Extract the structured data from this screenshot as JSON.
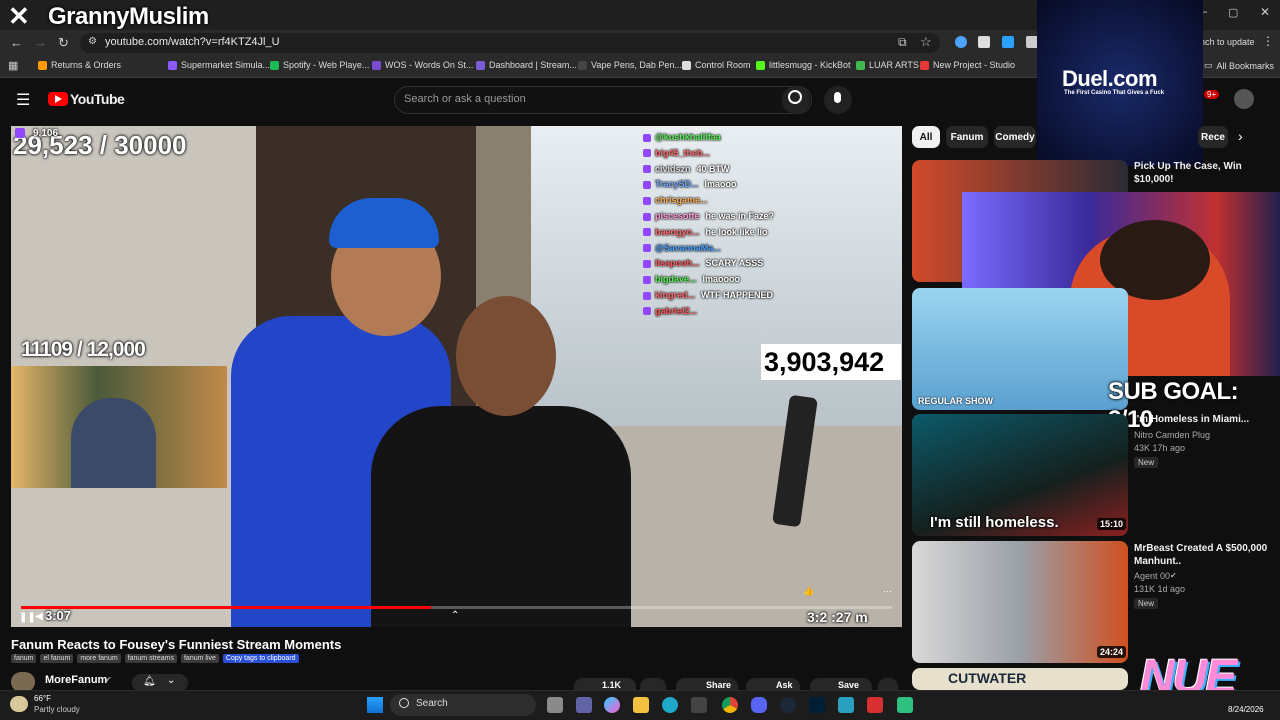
{
  "overlay": {
    "streamer_name": "GrannyMuslim",
    "viewer_count": "9,106",
    "counter_top": "29,523 / 30000",
    "counter_mid": "11109 / 12,000",
    "big_count": "3,903,942",
    "sub_goal": "SUB GOAL: 3/10",
    "ad_brand": "Duel.com",
    "ad_tagline": "The First Casino That Gives a Fuck",
    "logo_text": "NUE"
  },
  "browser": {
    "url": "youtube.com/watch?v=rf4KTZ4Jl_U",
    "relaunch_label": "nch to update",
    "bookmarks": [
      {
        "label": "Returns & Orders",
        "color": "#ff9900"
      },
      {
        "label": "Supermarket Simula...",
        "color": "#8a5cff"
      },
      {
        "label": "Spotify - Web Playe...",
        "color": "#1db954"
      },
      {
        "label": "WOS - Words On St...",
        "color": "#7b4bd1"
      },
      {
        "label": "Dashboard | Stream...",
        "color": "#7b5cd6"
      },
      {
        "label": "Vape Pens, Dab Pen...",
        "color": "#444444"
      },
      {
        "label": "Control Room",
        "color": "#dddddd"
      },
      {
        "label": "littlesmugg - KickBot",
        "color": "#53fc18"
      },
      {
        "label": "LUAR ARTS",
        "color": "#3fb950"
      },
      {
        "label": "New Project - Studio",
        "color": "#e53935"
      }
    ],
    "all_bookmarks": "All Bookmarks"
  },
  "youtube": {
    "logo_text": "YouTube",
    "search_placeholder": "Search or ask a question",
    "notif_count": "9+",
    "chips": [
      "All",
      "Fanum",
      "Comedy",
      "Rece"
    ],
    "video_title": "Fanum Reacts to Fousey's Funniest Stream Moments",
    "tags": [
      "fanum",
      "el fanum",
      "more fanum",
      "fanum streams",
      "fanum live"
    ],
    "copy_tags_label": "Copy tags to clipboard",
    "channel_name": "MoreFanum",
    "like_count": "1.1K",
    "share_label": "Share",
    "ask_label": "Ask",
    "save_label": "Save",
    "time_current": "3:07",
    "time_total": "3:2 :27 m"
  },
  "chat": [
    {
      "user": "@kushkhaliifaa",
      "msg": "",
      "color": "#5af05a"
    },
    {
      "user": "big45_theb...",
      "msg": "",
      "color": "#ff6b6b"
    },
    {
      "user": "cividszn",
      "msg": "40 BTW",
      "color": "#dddddd"
    },
    {
      "user": "TracySD...",
      "msg": "lmaooo",
      "color": "#6fa8ff"
    },
    {
      "user": "chrisgame...",
      "msg": "",
      "color": "#ffb35a"
    },
    {
      "user": "piscesotte",
      "msg": "he was in Faze?",
      "color": "#ff9ad5"
    },
    {
      "user": "baeogyo...",
      "msg": "he look like lio",
      "color": "#ff6b6b"
    },
    {
      "user": "@SavannaMa...",
      "msg": "",
      "color": "#4aa3ff"
    },
    {
      "user": "lisapooh...",
      "msg": "SCARY ASSS",
      "color": "#ff5a5a"
    },
    {
      "user": "bigdave...",
      "msg": "lmaoooo",
      "color": "#5af05a"
    },
    {
      "user": "kingred...",
      "msg": "WTF HAPPENED",
      "color": "#ff6b6b"
    },
    {
      "user": "gabriel2...",
      "msg": "",
      "color": "#ff5a5a"
    }
  ],
  "sidebar_videos": [
    {
      "title": "Pick Up The Case, Win $10,000!",
      "channel": "",
      "meta": "",
      "badge": "",
      "duration": ""
    },
    {
      "title": "",
      "channel": "",
      "meta": "",
      "badge": "",
      "duration": "",
      "thumb_text": "REGULAR SHOW"
    },
    {
      "title": "I'm Homeless in Miami...",
      "channel": "Nitro Camden Plug",
      "meta": "43K  17h ago",
      "badge": "New",
      "duration": "15:10",
      "thumb_text": "I'm still homeless."
    },
    {
      "title": "MrBeast Created A $500,000 Manhunt..",
      "channel": "Agent 00",
      "meta": "131K  1d ago",
      "badge": "New",
      "duration": "24:24"
    },
    {
      "title": "",
      "channel": "",
      "meta": "",
      "badge": "",
      "duration": "",
      "thumb_text": "CUTWATER"
    }
  ],
  "taskbar": {
    "weather_temp": "66°F",
    "weather_desc": "Partly cloudy",
    "search_label": "Search",
    "date": "8/24/2026"
  }
}
